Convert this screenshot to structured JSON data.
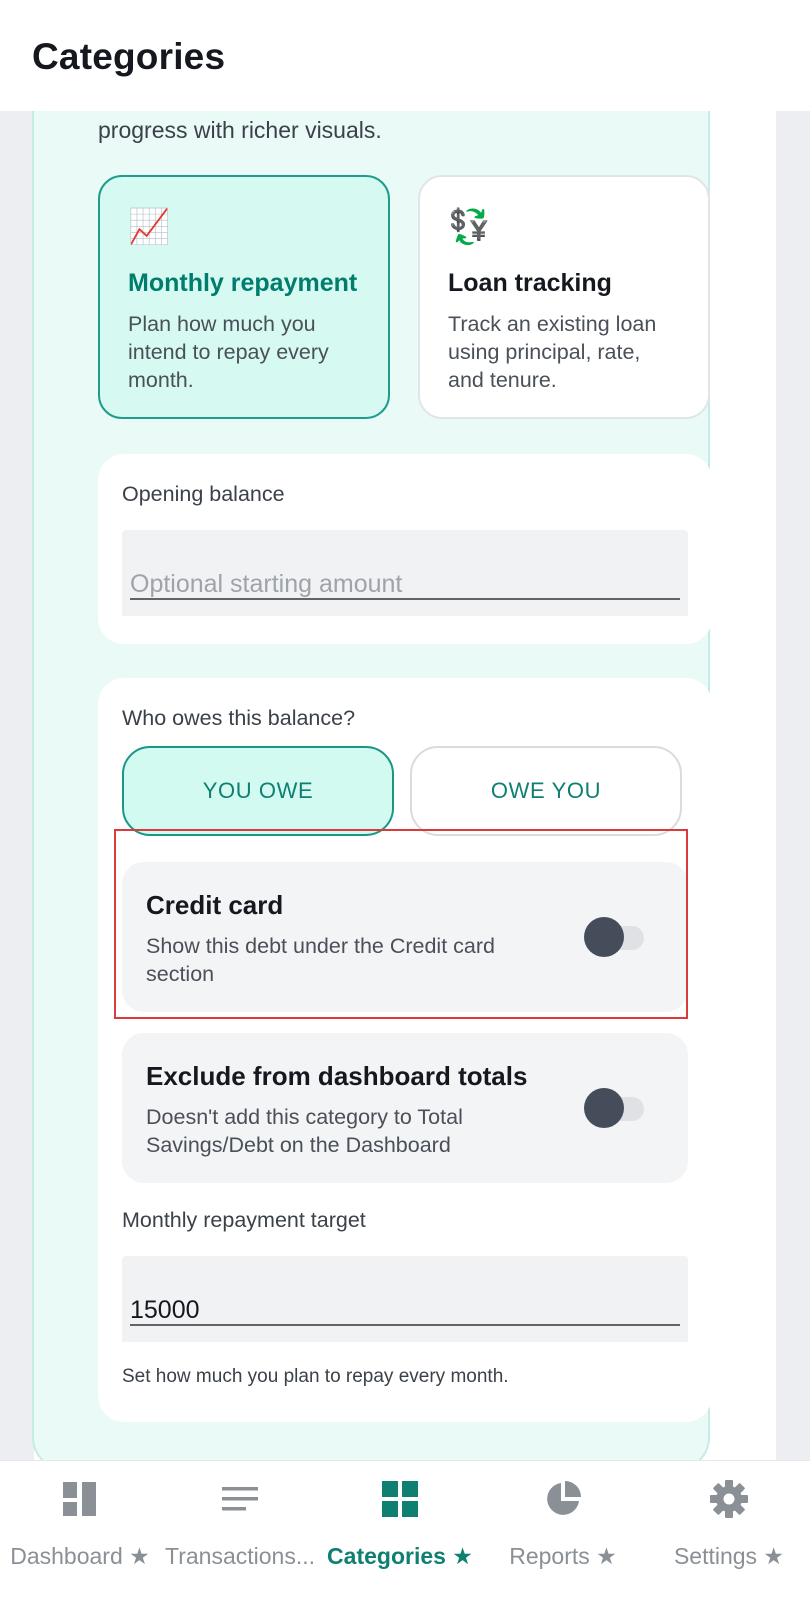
{
  "header": {
    "title": "Categories"
  },
  "intro": {
    "text": "progress with richer visuals."
  },
  "mode_options": [
    {
      "icon": "📈",
      "title": "Monthly repayment",
      "description": "Plan how much you intend to repay every month.",
      "selected": true
    },
    {
      "icon": "💱",
      "title": "Loan tracking",
      "description": "Track an existing loan using principal, rate, and tenure.",
      "selected": false
    }
  ],
  "opening_balance": {
    "label": "Opening balance",
    "placeholder": "Optional starting amount",
    "value": ""
  },
  "owes": {
    "label": "Who owes this balance?",
    "options": [
      "YOU OWE",
      "OWE YOU"
    ],
    "selected": "YOU OWE"
  },
  "credit_card": {
    "title": "Credit card",
    "description": "Show this debt under the Credit card section",
    "enabled": false
  },
  "exclude_totals": {
    "title": "Exclude from dashboard totals",
    "description": "Doesn't add this category to Total Savings/Debt on the Dashboard",
    "enabled": false
  },
  "repayment_target": {
    "label": "Monthly repayment target",
    "value": "15000",
    "hint": "Set how much you plan to repay every month."
  },
  "bottom_nav": [
    {
      "label": "Dashboard ★",
      "icon": "dashboard-icon",
      "active": false
    },
    {
      "label": "Transactions...",
      "icon": "list-icon",
      "active": false
    },
    {
      "label": "Categories ★",
      "icon": "grid-icon",
      "active": true
    },
    {
      "label": "Reports ★",
      "icon": "pie-chart-icon",
      "active": false
    },
    {
      "label": "Settings ★",
      "icon": "gear-icon",
      "active": false
    }
  ],
  "colors": {
    "accent": "#0f7f72",
    "accent_border": "#1f9d8c",
    "card_background": "#e9faf7",
    "selected_background": "#d6faf2",
    "highlight_border": "#d93a3a",
    "toggle_thumb": "#454d5a",
    "nav_inactive": "#8a9096"
  }
}
